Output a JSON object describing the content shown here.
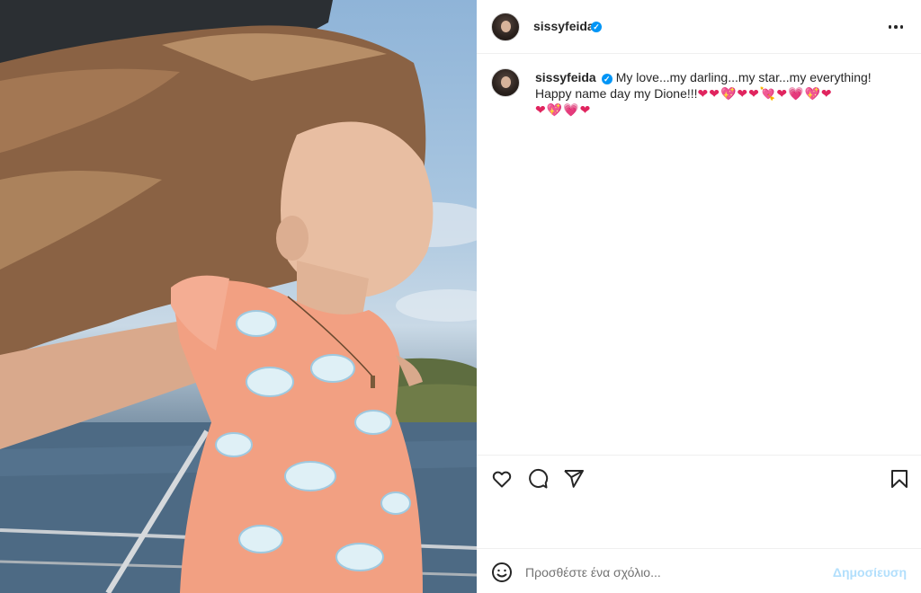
{
  "post": {
    "username": "sissyfeida",
    "verified_mark": "✓",
    "more_icon": "more-horizontal-icon"
  },
  "caption": {
    "username": "sissyfeida",
    "verified_mark": "✓",
    "line1": "My love...my darling...my star...my everything!",
    "line2": "Happy name day my Dione!!!",
    "hearts_line1": "❤❤💖❤❤💘❤💗💖❤",
    "hearts_line2": "❤💖💗❤"
  },
  "actions": {
    "like_icon": "heart-icon",
    "comment_icon": "comment-icon",
    "share_icon": "send-icon",
    "save_icon": "bookmark-icon"
  },
  "comment_box": {
    "emoji_icon": "smiley-icon",
    "placeholder": "Προσθέστε ένα σχόλιο...",
    "publish_label": "Δημοσίευση",
    "publish_color": "#b2dffc"
  },
  "colors": {
    "accent": "#0095f6",
    "text": "#262626",
    "border": "#efefef"
  }
}
